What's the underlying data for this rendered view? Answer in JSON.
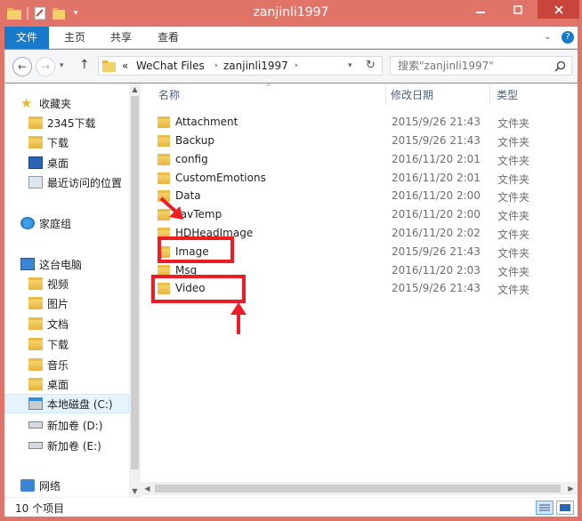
{
  "window": {
    "title": "zanjinli1997"
  },
  "ribbon": {
    "tabs": [
      "文件",
      "主页",
      "共享",
      "查看"
    ]
  },
  "address": {
    "prefix": "«",
    "segments": [
      "WeChat Files",
      "zanjinli1997"
    ],
    "search_placeholder": "搜索\"zanjinli1997\""
  },
  "nav": {
    "items": [
      {
        "label": "收藏夹",
        "icon": "star-icon"
      },
      {
        "label": "2345下载",
        "icon": "folder-icon"
      },
      {
        "label": "下载",
        "icon": "download-folder-icon"
      },
      {
        "label": "桌面",
        "icon": "desktop-icon"
      },
      {
        "label": "最近访问的位置",
        "icon": "recent-places-icon"
      },
      {
        "label": "家庭组",
        "icon": "homegroup-icon"
      },
      {
        "label": "这台电脑",
        "icon": "computer-icon"
      },
      {
        "label": "视频",
        "icon": "videos-folder-icon"
      },
      {
        "label": "图片",
        "icon": "pictures-folder-icon"
      },
      {
        "label": "文档",
        "icon": "documents-folder-icon"
      },
      {
        "label": "下载",
        "icon": "download-folder-icon"
      },
      {
        "label": "音乐",
        "icon": "music-folder-icon"
      },
      {
        "label": "桌面",
        "icon": "desktop-folder-icon"
      },
      {
        "label": "本地磁盘 (C:)",
        "icon": "system-drive-icon"
      },
      {
        "label": "新加卷 (D:)",
        "icon": "drive-icon"
      },
      {
        "label": "新加卷 (E:)",
        "icon": "drive-icon"
      },
      {
        "label": "网络",
        "icon": "network-icon"
      }
    ]
  },
  "list": {
    "columns": [
      "名称",
      "修改日期",
      "类型"
    ],
    "rows": [
      {
        "name": "Attachment",
        "date": "2015/9/26 21:43",
        "type": "文件夹"
      },
      {
        "name": "Backup",
        "date": "2015/9/26 21:43",
        "type": "文件夹"
      },
      {
        "name": "config",
        "date": "2016/11/20 2:01",
        "type": "文件夹"
      },
      {
        "name": "CustomEmotions",
        "date": "2016/11/20 2:01",
        "type": "文件夹"
      },
      {
        "name": "Data",
        "date": "2016/11/20 2:00",
        "type": "文件夹"
      },
      {
        "name": "FavTemp",
        "date": "2016/11/20 2:00",
        "type": "文件夹"
      },
      {
        "name": "HDHeadImage",
        "date": "2016/11/20 2:02",
        "type": "文件夹"
      },
      {
        "name": "Image",
        "date": "2015/9/26 21:43",
        "type": "文件夹"
      },
      {
        "name": "Msg",
        "date": "2016/11/20 2:03",
        "type": "文件夹"
      },
      {
        "name": "Video",
        "date": "2015/9/26 21:43",
        "type": "文件夹"
      }
    ]
  },
  "status": {
    "count": "10 个项目"
  },
  "colors": {
    "accent": "#1979ca",
    "titlebar": "#e07468",
    "highlight": "#ee1c24"
  }
}
